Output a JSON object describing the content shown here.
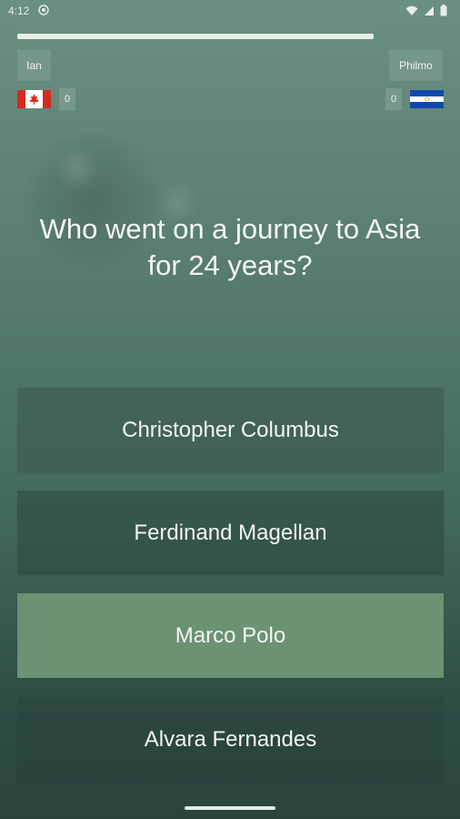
{
  "status_bar": {
    "time": "4:12"
  },
  "players": {
    "left": {
      "name": "Ian",
      "score": "0",
      "flag": "canada-flag"
    },
    "right": {
      "name": "Philmo",
      "score": "0",
      "flag": "el-salvador-flag"
    }
  },
  "timer": {
    "progress": 0.775
  },
  "question": {
    "text": "Who went on a journey to Asia for 24 years?"
  },
  "answers": [
    {
      "label": "Christopher Columbus"
    },
    {
      "label": "Ferdinand Magellan"
    },
    {
      "label": "Marco Polo",
      "highlighted": true
    },
    {
      "label": "Alvara Fernandes"
    }
  ],
  "colors": {
    "highlight": "#6b9273",
    "background_top": "#6c8f83",
    "background_bottom": "#2a443d"
  }
}
